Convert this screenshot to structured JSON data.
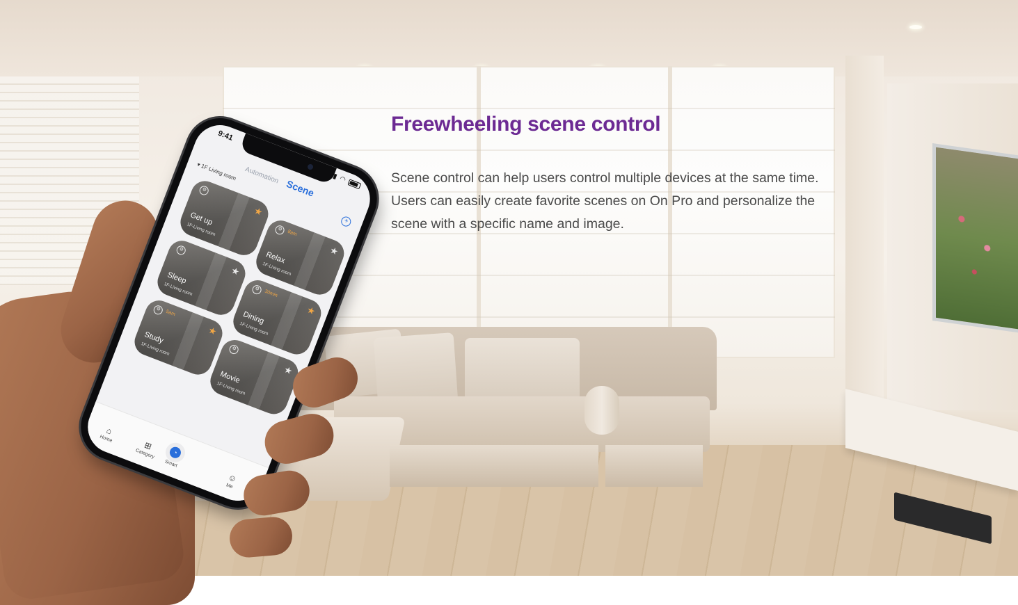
{
  "headline": "Freewheeling scene control",
  "body": "Scene control can help users control multiple devices at the same time. Users can easily create favorite scenes on On Pro and personalize the scene with a specific name and image.",
  "phone": {
    "status_time": "9:41",
    "tabs": {
      "automation": "Automation",
      "scene": "Scene"
    },
    "room_selector": "▾ 1F Living room",
    "add_icon": "plus-circle-icon",
    "cards": [
      {
        "name": "Get up",
        "room": "1F-Living room",
        "time": "",
        "starred": true,
        "star_color": "#f0a646"
      },
      {
        "name": "Relax",
        "room": "1F-Living room",
        "time": "8am",
        "starred": false,
        "star_color": "#e8e8e8"
      },
      {
        "name": "Sleep",
        "room": "1F-Living room",
        "time": "",
        "starred": false,
        "star_color": "#e8e8e8"
      },
      {
        "name": "Dining",
        "room": "1F-Living room",
        "time": "30min",
        "starred": true,
        "star_color": "#f0a646"
      },
      {
        "name": "Study",
        "room": "1F-Living room",
        "time": "5am",
        "starred": true,
        "star_color": "#f0a646"
      },
      {
        "name": "Movie",
        "room": "1F-Living room",
        "time": "",
        "starred": false,
        "star_color": "#e8e8e8"
      }
    ],
    "tabbar": {
      "home": "Home",
      "category": "Category",
      "smart": "Smart",
      "me": "Me"
    }
  },
  "colors": {
    "headline": "#6c2a93",
    "accent": "#2a6fdb",
    "star_active": "#f0a646"
  }
}
